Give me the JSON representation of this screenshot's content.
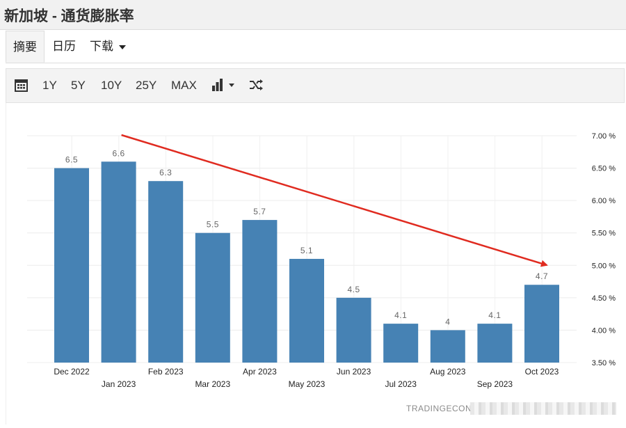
{
  "header": {
    "title": "新加坡 - 通货膨胀率"
  },
  "tabs": [
    {
      "label": "摘要",
      "active": true
    },
    {
      "label": "日历"
    },
    {
      "label": "下载",
      "dropdown": true
    }
  ],
  "toolbar": {
    "calendar_icon": "calendar-icon",
    "ranges": [
      "1Y",
      "5Y",
      "10Y",
      "25Y",
      "MAX"
    ],
    "chart_type_icon": "bar-chart-icon",
    "shuffle_icon": "shuffle-icon"
  },
  "chart_data": {
    "type": "bar",
    "categories": [
      "Dec 2022",
      "Jan 2023",
      "Feb 2023",
      "Mar 2023",
      "Apr 2023",
      "May 2023",
      "Jun 2023",
      "Jul 2023",
      "Aug 2023",
      "Sep 2023",
      "Oct 2023"
    ],
    "values": [
      6.5,
      6.6,
      6.3,
      5.5,
      5.7,
      5.1,
      4.5,
      4.1,
      4.0,
      4.1,
      4.7
    ],
    "data_labels": [
      "6.5",
      "6.6",
      "6.3",
      "5.5",
      "5.7",
      "5.1",
      "4.5",
      "4.1",
      "4",
      "4.1",
      "4.7"
    ],
    "ylim": [
      3.5,
      7.0
    ],
    "yticks": [
      7.0,
      6.5,
      6.0,
      5.5,
      5.0,
      4.5,
      4.0,
      3.5
    ],
    "ytick_labels": [
      "7.00 %",
      "6.50 %",
      "6.00 %",
      "5.50 %",
      "5.00 %",
      "4.50 %",
      "4.00 %",
      "3.50 %"
    ],
    "y_axis_side": "right",
    "grid": true,
    "bar_color": "#4682b4",
    "annotation": {
      "type": "arrow",
      "color": "#e02b20",
      "from": [
        "Jan 2023",
        7.0
      ],
      "to": [
        "Oct 2023",
        4.95
      ]
    }
  },
  "footer": {
    "watermark": "TRADINGECONO"
  }
}
